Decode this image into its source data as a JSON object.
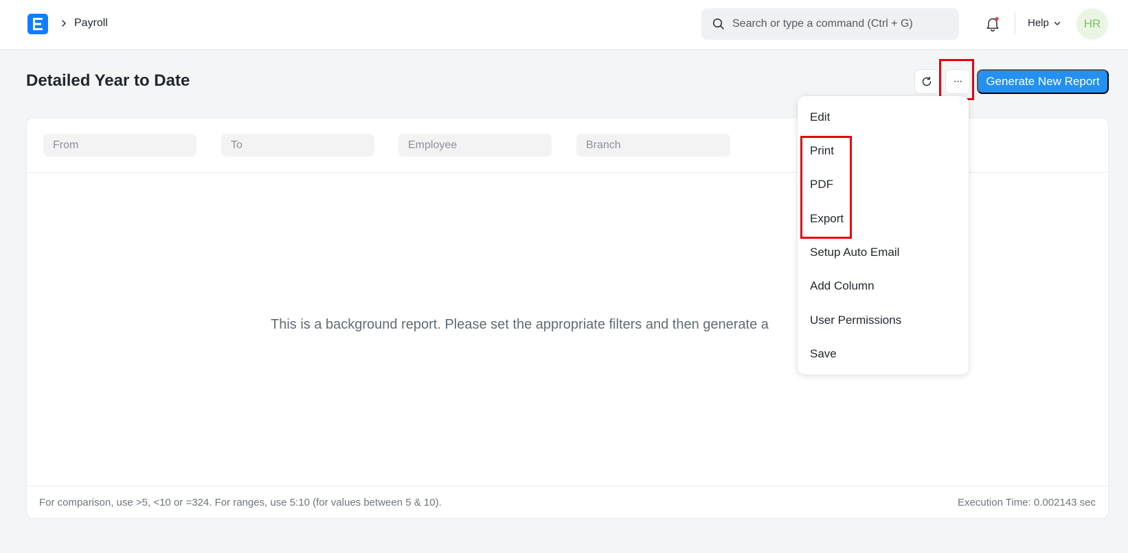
{
  "navbar": {
    "breadcrumb": "Payroll",
    "search_placeholder": "Search or type a command (Ctrl + G)",
    "help_label": "Help",
    "avatar_initials": "HR"
  },
  "page": {
    "title": "Detailed Year to Date",
    "generate_label": "Generate New Report",
    "more_label": "···"
  },
  "filters": [
    {
      "placeholder": "From"
    },
    {
      "placeholder": "To"
    },
    {
      "placeholder": "Employee"
    },
    {
      "placeholder": "Branch"
    }
  ],
  "report": {
    "empty_message": "This is a background report. Please set the appropriate filters and then generate a",
    "footer_hint": "For comparison, use >5, <10 or =324. For ranges, use 5:10 (for values between 5 & 10).",
    "execution_time": "Execution Time: 0.002143 sec"
  },
  "menu": {
    "items": [
      {
        "label": "Edit"
      },
      {
        "label": "Print"
      },
      {
        "label": "PDF"
      },
      {
        "label": "Export"
      },
      {
        "label": "Setup Auto Email"
      },
      {
        "label": "Add Column"
      },
      {
        "label": "User Permissions"
      },
      {
        "label": "Save"
      }
    ]
  },
  "colors": {
    "primary": "#2490ef",
    "logo": "#0f7fff",
    "highlight": "#e8000b",
    "avatar_bg": "#eaf6e3",
    "avatar_text": "#78c45b",
    "notification_dot": "#e24c4c"
  },
  "icons": {
    "logo": "frappe-logo-icon",
    "breadcrumb_sep": "chevron-right-icon",
    "search": "search-icon",
    "notifications": "bell-icon",
    "help_dropdown": "chevron-down-icon",
    "refresh": "refresh-icon",
    "more": "ellipsis-icon"
  }
}
